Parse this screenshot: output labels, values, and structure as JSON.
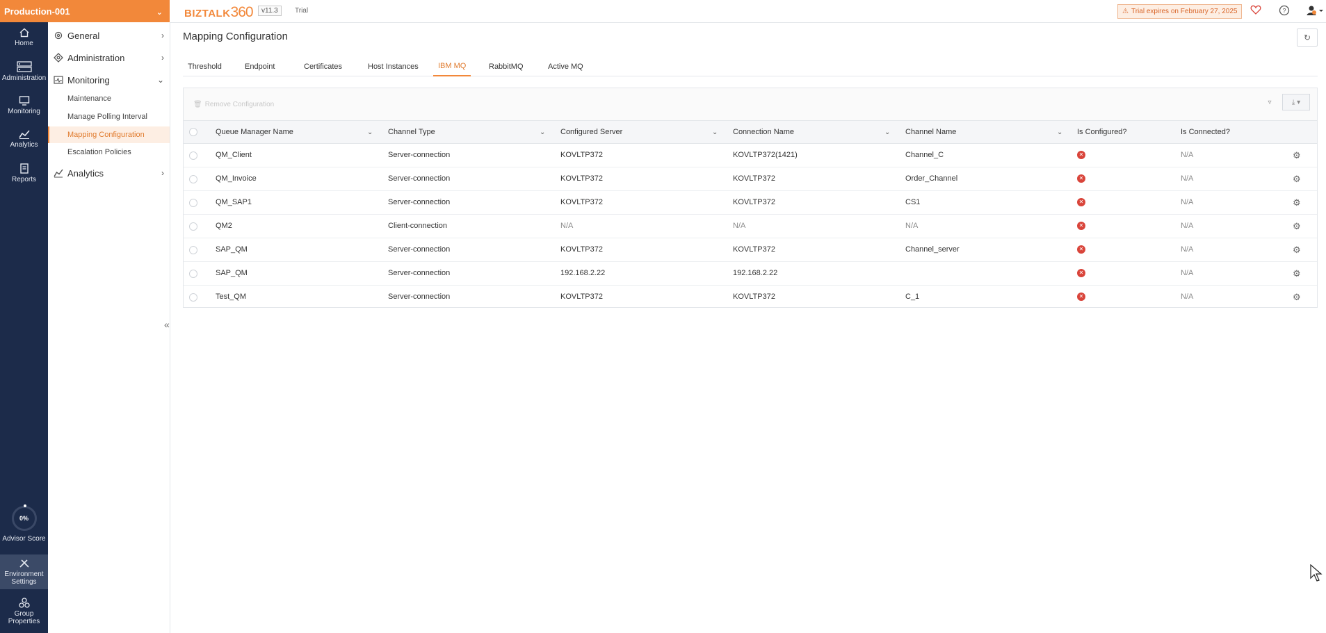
{
  "environment": {
    "name": "Production-001"
  },
  "rail": {
    "items": [
      {
        "label": "Home",
        "icon": "home-icon"
      },
      {
        "label": "Administration",
        "icon": "server-icon"
      },
      {
        "label": "Monitoring",
        "icon": "monitor-icon"
      },
      {
        "label": "Analytics",
        "icon": "chart-icon"
      },
      {
        "label": "Reports",
        "icon": "report-icon"
      }
    ],
    "advisor": {
      "value": "0%",
      "label": "Advisor Score"
    },
    "env_settings": {
      "line1": "Environment",
      "line2": "Settings"
    },
    "group_properties": {
      "line1": "Group",
      "line2": "Properties"
    }
  },
  "subnav": {
    "general": "General",
    "administration": "Administration",
    "monitoring": "Monitoring",
    "monitoring_items": [
      "Maintenance",
      "Manage Polling Interval",
      "Mapping Configuration",
      "Escalation Policies"
    ],
    "analytics": "Analytics"
  },
  "header": {
    "logo_text": "BIZTALK",
    "logo_num": "360",
    "version": "v11.3",
    "trial": "Trial",
    "expiry": "Trial expires on February 27, 2025"
  },
  "page": {
    "title": "Mapping Configuration",
    "tabs": [
      "Threshold",
      "Endpoint",
      "Certificates",
      "Host Instances",
      "IBM MQ",
      "RabbitMQ",
      "Active MQ"
    ],
    "active_tab": "IBM MQ"
  },
  "grid": {
    "remove_label": "Remove Configuration",
    "columns": [
      "Queue Manager Name",
      "Channel Type",
      "Configured Server",
      "Connection Name",
      "Channel Name",
      "Is Configured?",
      "Is Connected?"
    ],
    "rows": [
      {
        "qm": "QM_Client",
        "type": "Server-connection",
        "server": "KOVLTP372",
        "conn": "KOVLTP372(1421)",
        "channel": "Channel_C",
        "connected": "N/A"
      },
      {
        "qm": "QM_Invoice",
        "type": "Server-connection",
        "server": "KOVLTP372",
        "conn": "KOVLTP372",
        "channel": "Order_Channel",
        "connected": "N/A"
      },
      {
        "qm": "QM_SAP1",
        "type": "Server-connection",
        "server": "KOVLTP372",
        "conn": "KOVLTP372",
        "channel": "CS1",
        "connected": "N/A"
      },
      {
        "qm": "QM2",
        "type": "Client-connection",
        "server": "N/A",
        "conn": "N/A",
        "channel": "N/A",
        "connected": "N/A"
      },
      {
        "qm": "SAP_QM",
        "type": "Server-connection",
        "server": "KOVLTP372",
        "conn": "KOVLTP372",
        "channel": "Channel_server",
        "connected": "N/A"
      },
      {
        "qm": "SAP_QM",
        "type": "Server-connection",
        "server": "192.168.2.22",
        "conn": "192.168.2.22",
        "channel": "",
        "connected": "N/A"
      },
      {
        "qm": "Test_QM",
        "type": "Server-connection",
        "server": "KOVLTP372",
        "conn": "KOVLTP372",
        "channel": "C_1",
        "connected": "N/A"
      }
    ]
  },
  "colors": {
    "accent": "#f2883a",
    "rail": "#1c2b4a",
    "error": "#d9443a"
  }
}
